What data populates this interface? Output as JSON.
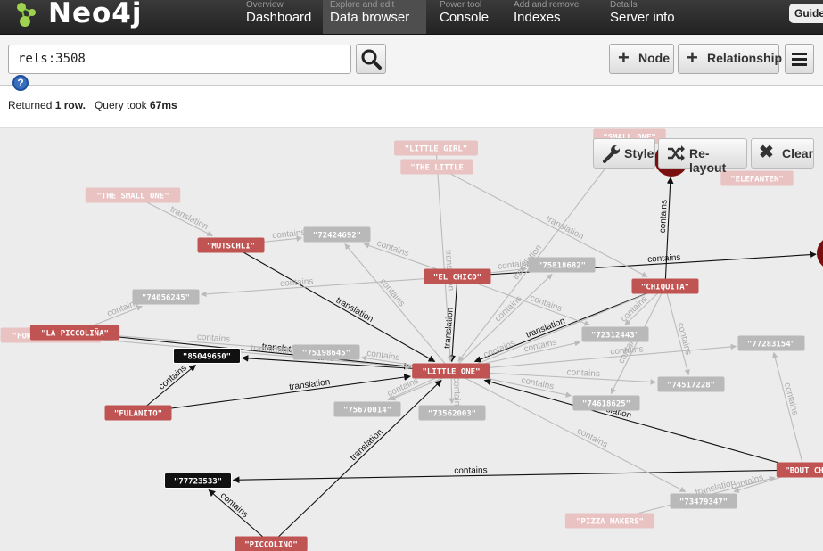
{
  "app": {
    "logo_text": "Neo4j"
  },
  "nav": {
    "tabs": [
      {
        "sub": "Overview",
        "label": "Dashboard"
      },
      {
        "sub": "Explore and edit",
        "label": "Data browser"
      },
      {
        "sub": "Power tool",
        "label": "Console"
      },
      {
        "sub": "Add and remove",
        "label": "Indexes"
      },
      {
        "sub": "Details",
        "label": "Server info"
      }
    ],
    "guide_label": "Guide"
  },
  "toolbar": {
    "query": "rels:3508",
    "node_label": "Node",
    "relationship_label": "Relationship"
  },
  "status": {
    "prefix": "Returned",
    "rows": "1 row.",
    "mid": "Query took",
    "time": "67ms"
  },
  "graph_controls": {
    "style_label": "Style",
    "relayout_label": "Re-layout",
    "clear_label": "Clear"
  },
  "colors": {
    "node_red": "#c05453",
    "node_black": "#111111",
    "node_grey": "#b9b9b9",
    "node_faded": "#e9c2c2",
    "edge_dark": "#111111",
    "edge_light": "#bbbbbb",
    "circle_dark": "#7a0f0f"
  },
  "graph": {
    "nodes": [
      {
        "id": "little_girl",
        "label": "\"LITTLE GIRL\"",
        "kind": "faded"
      },
      {
        "id": "the_little",
        "label": "\"THE LITTLE",
        "kind": "faded"
      },
      {
        "id": "small_one",
        "label": "\"SMALL ONE\"",
        "kind": "faded"
      },
      {
        "id": "elefanten",
        "label": "\"ELEFANTEN\"",
        "kind": "faded"
      },
      {
        "id": "the_small_one",
        "label": "\"THE SMALL ONE\"",
        "kind": "faded"
      },
      {
        "id": "for_the_family",
        "label": "\"FOR THE FAMILY\"",
        "kind": "faded"
      },
      {
        "id": "pizza_makers",
        "label": "\"PIZZA MAKERS\"",
        "kind": "faded"
      },
      {
        "id": "mutschli",
        "label": "\"MUTSCHLI\"",
        "kind": "red"
      },
      {
        "id": "el_chico",
        "label": "\"EL CHICO\"",
        "kind": "red"
      },
      {
        "id": "chiquita",
        "label": "\"CHIQUITA\"",
        "kind": "red"
      },
      {
        "id": "la_piccolina",
        "label": "\"LA PICCOLIÑA\"",
        "kind": "red"
      },
      {
        "id": "little_one",
        "label": "\"LITTLE ONE\"",
        "kind": "red"
      },
      {
        "id": "fulanito",
        "label": "\"FULANITO\"",
        "kind": "red"
      },
      {
        "id": "piccolino",
        "label": "\"PICCOLINO\"",
        "kind": "red"
      },
      {
        "id": "bout_ch",
        "label": "\"BOUT CH",
        "kind": "red"
      },
      {
        "id": "n85049650",
        "label": "\"85049650\"",
        "kind": "black"
      },
      {
        "id": "n77723533",
        "label": "\"77723533\"",
        "kind": "black"
      },
      {
        "id": "n72424692",
        "label": "\"72424692\"",
        "kind": "grey"
      },
      {
        "id": "n75818682",
        "label": "\"75818682\"",
        "kind": "grey"
      },
      {
        "id": "n74056245",
        "label": "\"74056245\"",
        "kind": "grey"
      },
      {
        "id": "n75198645",
        "label": "\"75198645\"",
        "kind": "grey"
      },
      {
        "id": "n72312443",
        "label": "\"72312443\"",
        "kind": "grey"
      },
      {
        "id": "n77283154",
        "label": "\"77283154\"",
        "kind": "grey"
      },
      {
        "id": "n74517228",
        "label": "\"74517228\"",
        "kind": "grey"
      },
      {
        "id": "n74618625",
        "label": "\"74618625\"",
        "kind": "grey"
      },
      {
        "id": "n75670014",
        "label": "\"75670014\"",
        "kind": "grey"
      },
      {
        "id": "n73562003",
        "label": "\"73562003\"",
        "kind": "grey"
      },
      {
        "id": "n73479347",
        "label": "\"73479347\"",
        "kind": "grey"
      },
      {
        "id": "circle_top",
        "label": "",
        "kind": "circle"
      },
      {
        "id": "circle_right",
        "label": "",
        "kind": "circle"
      }
    ],
    "edges": [
      {
        "from": "mutschli",
        "to": "little_one",
        "label": "translation",
        "dark": true
      },
      {
        "from": "el_chico",
        "to": "little_one",
        "label": "translation",
        "dark": true
      },
      {
        "from": "chiquita",
        "to": "little_one",
        "label": "translation",
        "dark": true
      },
      {
        "from": "la_piccolina",
        "to": "little_one",
        "label": "translation",
        "dark": true
      },
      {
        "from": "fulanito",
        "to": "little_one",
        "label": "translation",
        "dark": true
      },
      {
        "from": "piccolino",
        "to": "little_one",
        "label": "translation",
        "dark": true
      },
      {
        "from": "bout_ch",
        "to": "little_one",
        "label": "translation",
        "dark": true
      },
      {
        "from": "little_one",
        "to": "n85049650",
        "label": "contains",
        "dark": true
      },
      {
        "from": "fulanito",
        "to": "n85049650",
        "label": "contains",
        "dark": true
      },
      {
        "from": "bout_ch",
        "to": "n77723533",
        "label": "contains",
        "dark": true
      },
      {
        "from": "piccolino",
        "to": "n77723533",
        "label": "contains",
        "dark": true
      },
      {
        "from": "chiquita",
        "to": "circle_top",
        "label": "contains",
        "dark": true
      },
      {
        "from": "el_chico",
        "to": "circle_right",
        "label": "contains",
        "dark": true
      },
      {
        "from": "mutschli",
        "to": "n72424692",
        "label": "contains",
        "dark": false
      },
      {
        "from": "el_chico",
        "to": "n72424692",
        "label": "contains",
        "dark": false
      },
      {
        "from": "el_chico",
        "to": "n75818682",
        "label": "contains",
        "dark": false
      },
      {
        "from": "el_chico",
        "to": "n74056245",
        "label": "contains",
        "dark": false
      },
      {
        "from": "el_chico",
        "to": "n72312443",
        "label": "contains",
        "dark": false
      },
      {
        "from": "little_one",
        "to": "n75818682",
        "label": "contains",
        "dark": false
      },
      {
        "from": "little_one",
        "to": "n72424692",
        "label": "contains",
        "dark": false
      },
      {
        "from": "little_one",
        "to": "n75198645",
        "label": "contains",
        "dark": false
      },
      {
        "from": "little_one",
        "to": "n72312443",
        "label": "contains",
        "dark": false
      },
      {
        "from": "little_one",
        "to": "n77283154",
        "label": "contains",
        "dark": false
      },
      {
        "from": "little_one",
        "to": "n74517228",
        "label": "contains",
        "dark": false
      },
      {
        "from": "little_one",
        "to": "n74618625",
        "label": "contains",
        "dark": false
      },
      {
        "from": "little_one",
        "to": "n75670014",
        "label": "contains",
        "dark": false
      },
      {
        "from": "little_one",
        "to": "n73562003",
        "label": "contains",
        "dark": false
      },
      {
        "from": "little_one",
        "to": "n73479347",
        "label": "contains",
        "dark": false
      },
      {
        "from": "chiquita",
        "to": "n74517228",
        "label": "contains",
        "dark": false
      },
      {
        "from": "chiquita",
        "to": "n74618625",
        "label": "contains",
        "dark": false
      },
      {
        "from": "chiquita",
        "to": "n75670014",
        "label": "contains",
        "dark": false
      },
      {
        "from": "la_piccolina",
        "to": "n74056245",
        "label": "contains",
        "dark": false
      },
      {
        "from": "la_piccolina",
        "to": "n75198645",
        "label": "contains",
        "dark": false
      },
      {
        "from": "the_small_one",
        "to": "mutschli",
        "label": "translation",
        "dark": false
      },
      {
        "from": "little_girl",
        "to": "little_one",
        "label": "translation",
        "dark": false
      },
      {
        "from": "the_little",
        "to": "chiquita",
        "label": "translation",
        "dark": false
      },
      {
        "from": "small_one",
        "to": "little_one",
        "label": "translation",
        "dark": false
      },
      {
        "from": "pizza_makers",
        "to": "bout_ch",
        "label": "translation",
        "dark": false
      },
      {
        "from": "for_the_family",
        "to": "little_one",
        "label": "translation",
        "dark": false
      },
      {
        "from": "bout_ch",
        "to": "n73479347",
        "label": "contains",
        "dark": false
      },
      {
        "from": "bout_ch",
        "to": "n77283154",
        "label": "contains",
        "dark": false
      },
      {
        "from": "chiquita",
        "to": "n72312443",
        "label": "contains",
        "dark": false
      }
    ]
  }
}
